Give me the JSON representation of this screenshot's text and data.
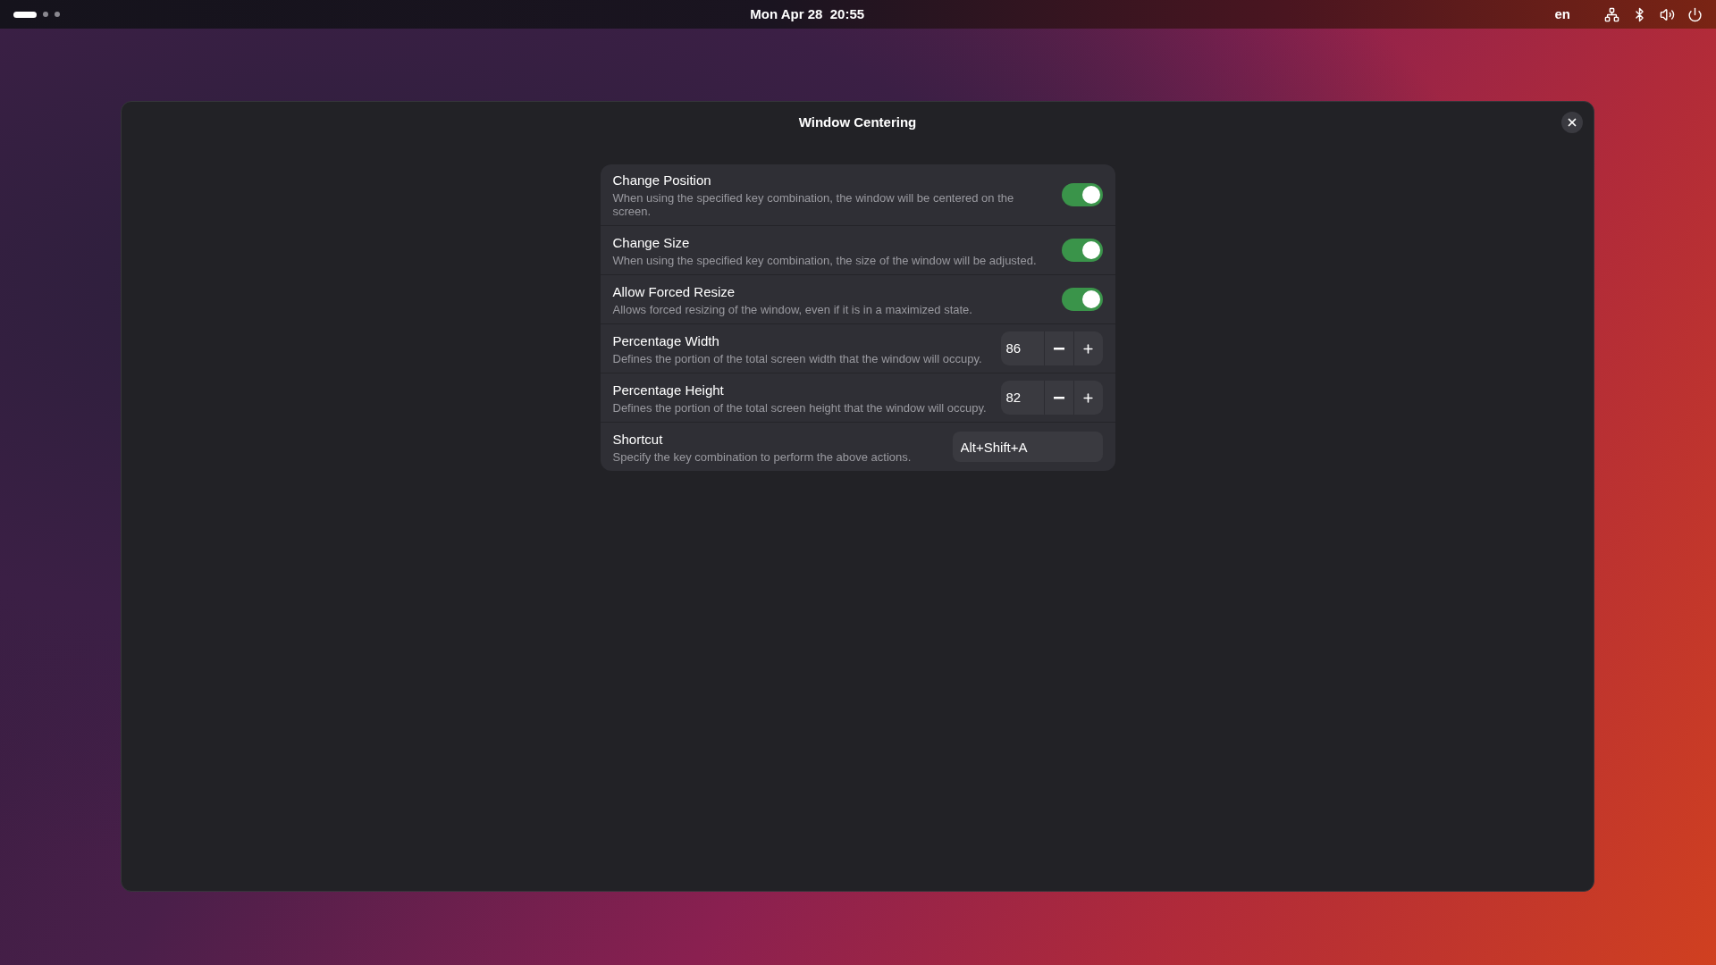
{
  "top_bar": {
    "workspaces": [
      {
        "selected": true
      },
      {
        "selected": false
      },
      {
        "selected": false
      }
    ],
    "clock": "Mon Apr 28  20:55",
    "keyboard_layout": "en"
  },
  "window": {
    "title": "Window Centering",
    "rows": [
      {
        "kind": "switch",
        "title": "Change Position",
        "description": "When using the specified key combination, the window will be centered on the screen.",
        "on": true
      },
      {
        "kind": "switch",
        "title": "Change Size",
        "description": "When using the specified key combination, the size of the window will be adjusted.",
        "on": true
      },
      {
        "kind": "switch",
        "title": "Allow Forced Resize",
        "description": "Allows forced resizing of the window, even if it is in a maximized state.",
        "on": true
      },
      {
        "kind": "spin",
        "title": "Percentage Width",
        "description": "Defines the portion of the total screen width that the window will occupy.",
        "value": "86"
      },
      {
        "kind": "spin",
        "title": "Percentage Height",
        "description": "Defines the portion of the total screen height that the window will occupy.",
        "value": "82"
      },
      {
        "kind": "entry",
        "title": "Shortcut",
        "description": "Specify the key combination to perform the above actions.",
        "value": "Alt+Shift+A"
      }
    ]
  }
}
